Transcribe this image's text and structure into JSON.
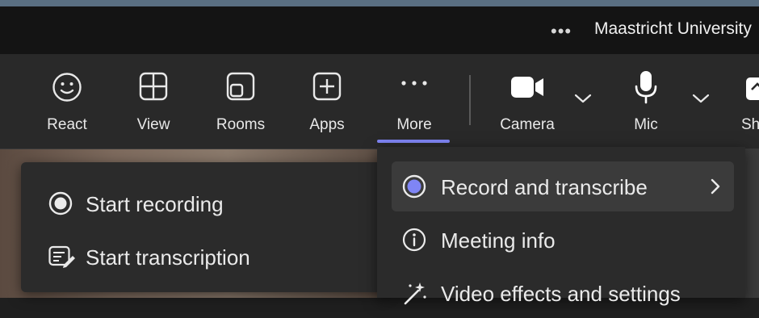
{
  "title_bar": {
    "more_dots": "•••",
    "org_name": "Maastricht University"
  },
  "toolbar": {
    "buttons": [
      {
        "label": "React",
        "icon": "smiley-icon"
      },
      {
        "label": "View",
        "icon": "grid-icon"
      },
      {
        "label": "Rooms",
        "icon": "rooms-icon"
      },
      {
        "label": "Apps",
        "icon": "apps-plus-icon"
      },
      {
        "label": "More",
        "icon": "ellipsis-icon",
        "active": true
      },
      {
        "label": "Camera",
        "icon": "camera-icon"
      },
      {
        "label": "Mic",
        "icon": "microphone-icon"
      },
      {
        "label": "Sh",
        "icon": "share-icon"
      }
    ],
    "accent_color": "#7f85f5"
  },
  "record_submenu": {
    "items": [
      {
        "label": "Start recording",
        "icon": "record-icon"
      },
      {
        "label": "Start transcription",
        "icon": "transcript-icon"
      }
    ]
  },
  "more_menu": {
    "items": [
      {
        "label": "Record and transcribe",
        "icon": "record-filled-icon",
        "has_submenu": true
      },
      {
        "label": "Meeting info",
        "icon": "info-icon"
      },
      {
        "label": "Video effects and settings",
        "icon": "magic-wand-icon"
      }
    ]
  }
}
